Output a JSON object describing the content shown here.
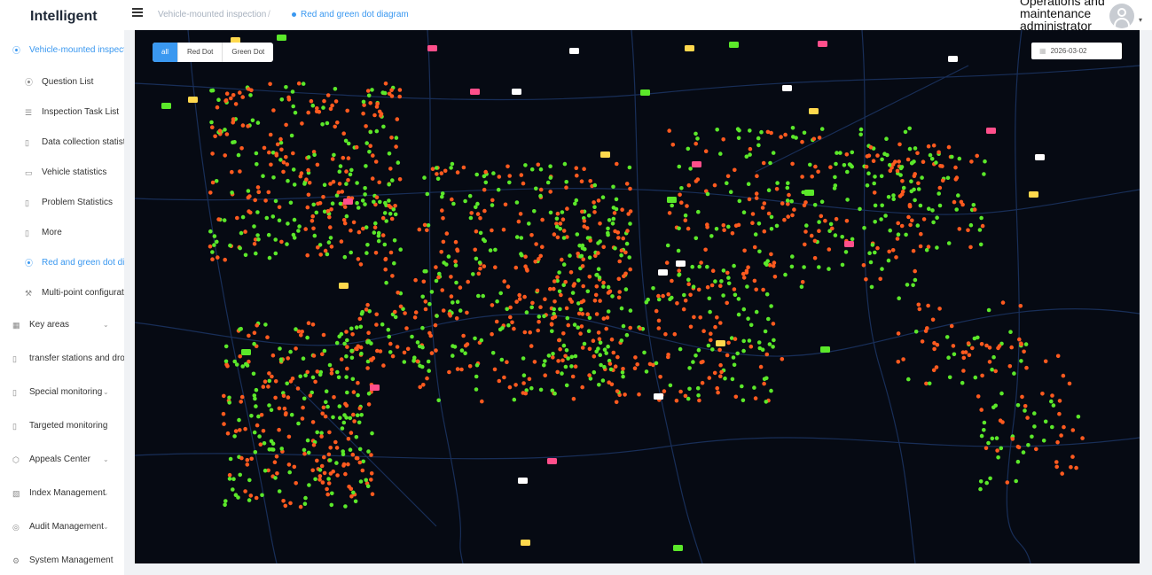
{
  "app": {
    "title": "Intelligent"
  },
  "sidebar": {
    "items": [
      {
        "label": "Vehicle-mounted inspection",
        "icon": "location-icon",
        "glyph": "⦿",
        "level": "top",
        "active": true
      },
      {
        "label": "Question List",
        "icon": "location-icon",
        "glyph": "⦿",
        "level": "sub",
        "active": false
      },
      {
        "label": "Inspection Task List",
        "icon": "list-icon",
        "glyph": "☰",
        "level": "sub",
        "active": false
      },
      {
        "label": "Data collection statistics",
        "icon": "book-icon",
        "glyph": "▯",
        "level": "sub",
        "active": false
      },
      {
        "label": "Vehicle statistics",
        "icon": "monitor-icon",
        "glyph": "▭",
        "level": "sub",
        "active": false
      },
      {
        "label": "Problem Statistics",
        "icon": "book-icon",
        "glyph": "▯",
        "level": "sub",
        "active": false
      },
      {
        "label": "More",
        "icon": "book-icon",
        "glyph": "▯",
        "level": "sub",
        "active": false
      },
      {
        "label": "Red and green dot diagram",
        "icon": "location-icon",
        "glyph": "⦿",
        "level": "sub",
        "active": true
      },
      {
        "label": "Multi-point configuration",
        "icon": "tools-icon",
        "glyph": "⚒",
        "level": "sub",
        "active": false
      },
      {
        "label": "Key areas",
        "icon": "grid-icon",
        "glyph": "▦",
        "level": "top",
        "active": false,
        "arrow": true
      },
      {
        "label": "transfer stations and drop",
        "icon": "book-icon",
        "glyph": "▯",
        "level": "top",
        "active": false
      },
      {
        "label": "Special monitoring",
        "icon": "book-icon",
        "glyph": "▯",
        "level": "top",
        "active": false,
        "arrow": true
      },
      {
        "label": "Targeted monitoring",
        "icon": "book-icon",
        "glyph": "▯",
        "level": "top",
        "active": false,
        "arrow": true
      },
      {
        "label": "Appeals Center",
        "icon": "cube-icon",
        "glyph": "⬡",
        "level": "top",
        "active": false,
        "arrow": true
      },
      {
        "label": "Index Management",
        "icon": "chart-icon",
        "glyph": "▧",
        "level": "top",
        "active": false,
        "arrow": true
      },
      {
        "label": "Audit Management",
        "icon": "audit-icon",
        "glyph": "◎",
        "level": "top",
        "active": false,
        "arrow": true
      },
      {
        "label": "System Management",
        "icon": "gear-icon",
        "glyph": "⚙",
        "level": "top",
        "active": false
      }
    ]
  },
  "header": {
    "breadcrumb": [
      "Vehicle-mounted inspection",
      "Red and green dot diagram"
    ],
    "separator": "/",
    "user": "Operations and maintenance administrator",
    "caret": "▾"
  },
  "filter": {
    "options": [
      "all",
      "Red Dot",
      "Green Dot"
    ],
    "selected": "all"
  },
  "date": {
    "value": "2026-03-02",
    "icon": "calendar-icon"
  },
  "colors": {
    "accent": "#3a98f0",
    "red_dot": "#ff5a1f",
    "green_dot": "#5be82a",
    "map_bg": "#060a13",
    "road": "#1b3360"
  }
}
